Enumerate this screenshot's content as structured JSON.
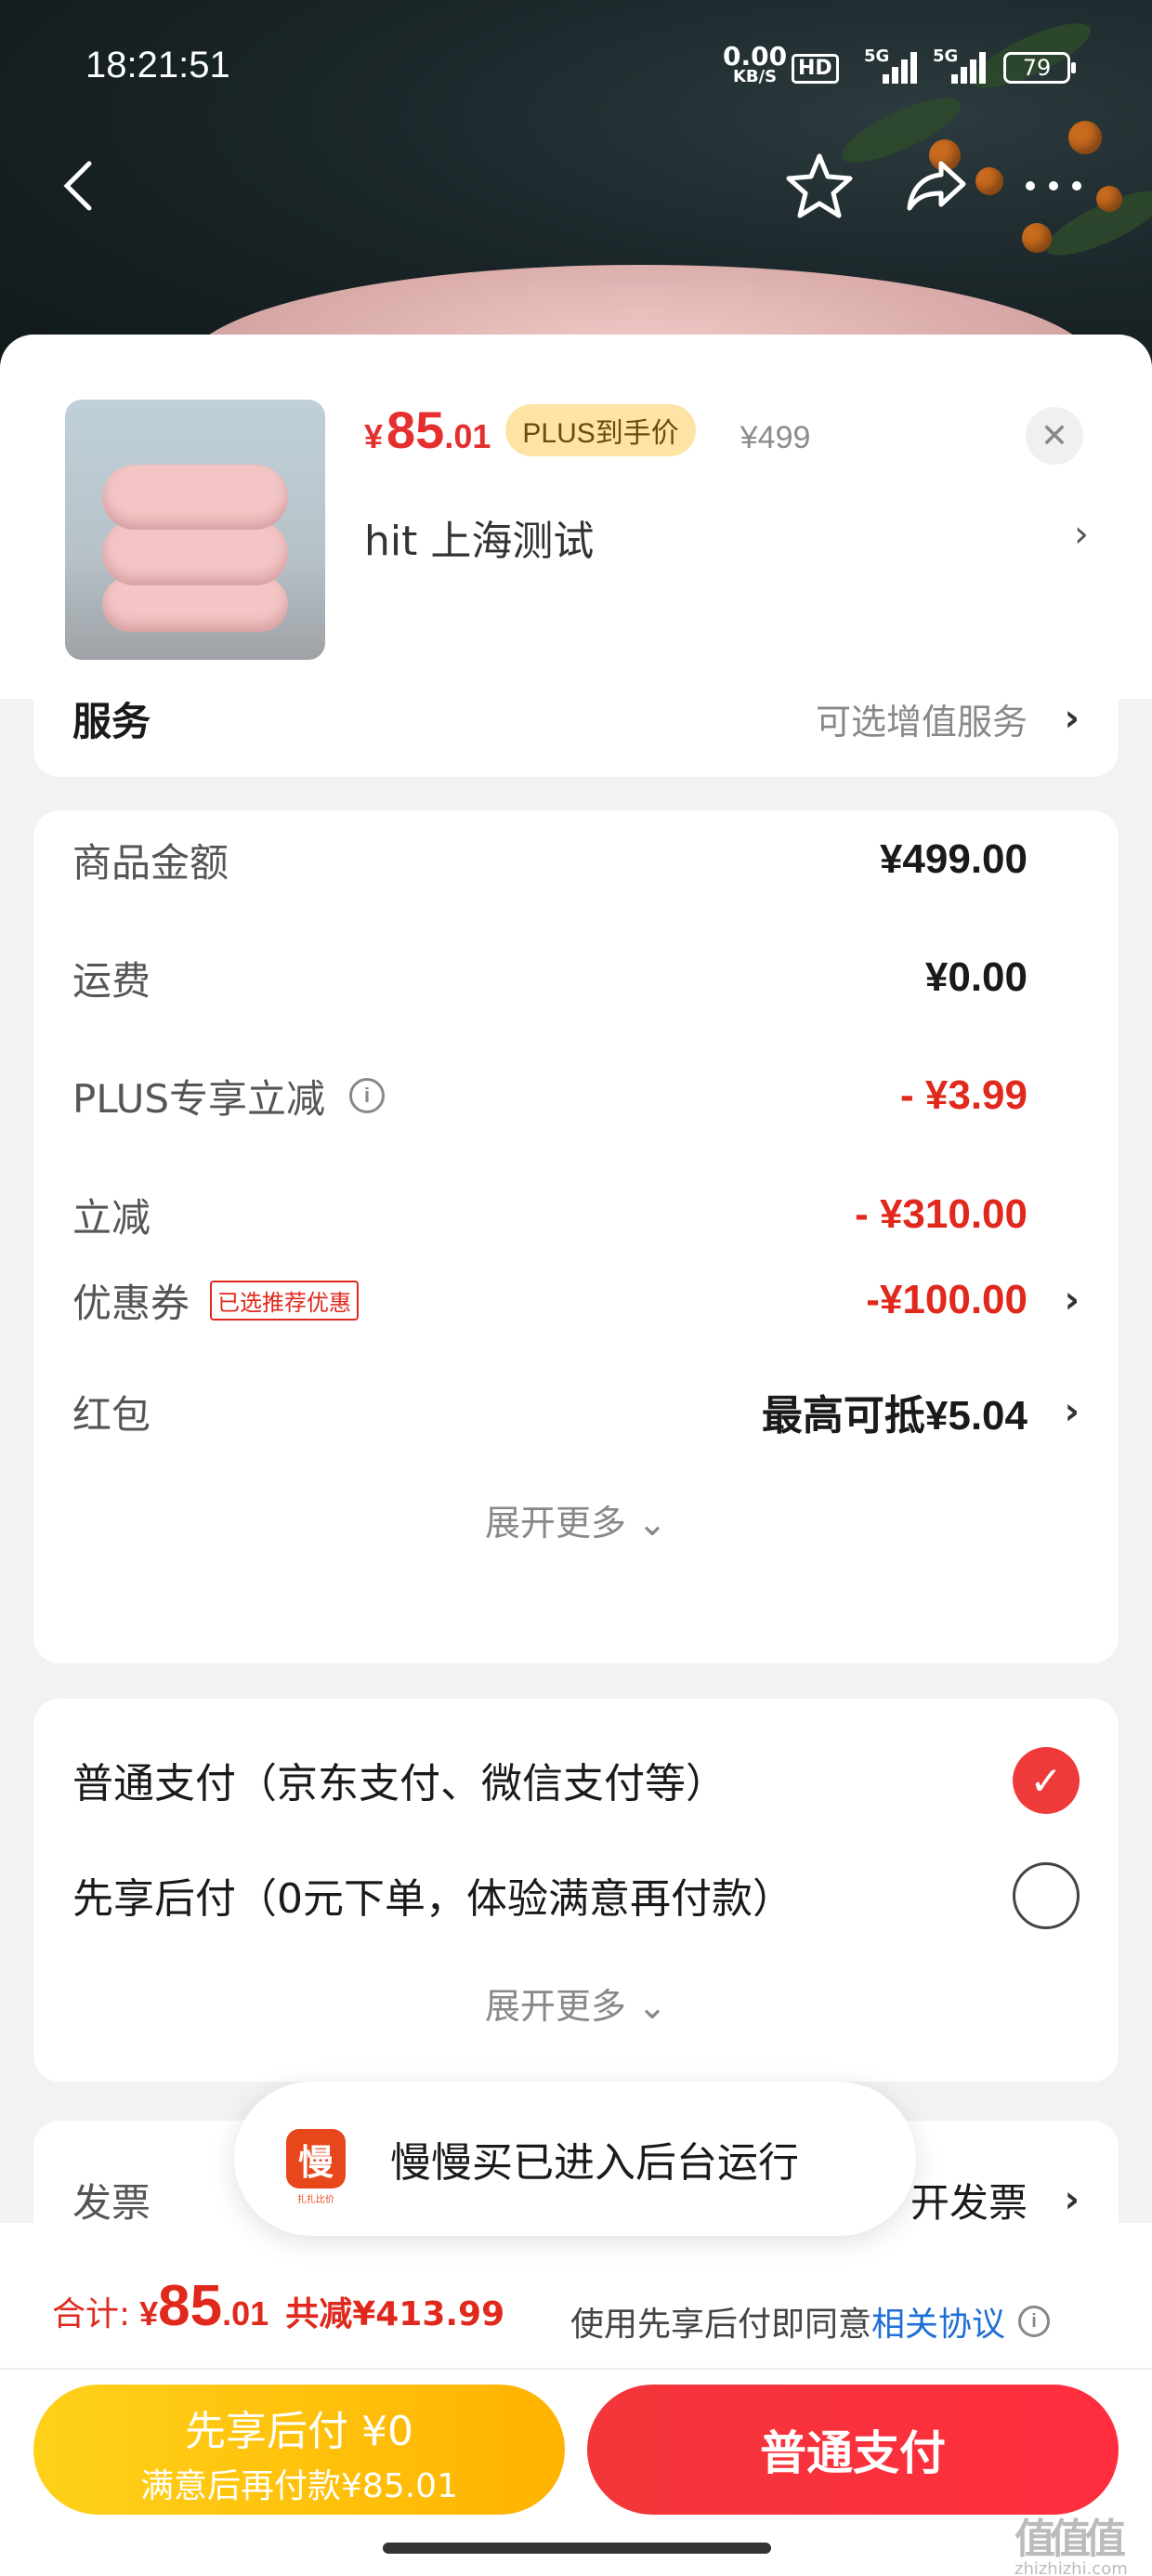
{
  "status_bar": {
    "time": "18:21:51",
    "net_speed": "0.00",
    "net_unit": "KB/S",
    "hd_label": "HD",
    "signal_1": "5G",
    "signal_2": "5G",
    "battery": "79"
  },
  "product": {
    "price_yen": "¥",
    "price_int": "85",
    "price_dec": ".01",
    "plus_tag": "PLUS到手价",
    "original_price": "¥499",
    "spec": "hit 上海测试"
  },
  "service_row": {
    "label": "服务",
    "value": "可选增值服务"
  },
  "price_detail": {
    "rows": [
      {
        "label": "商品金额",
        "value": "¥499.00"
      },
      {
        "label": "运费",
        "value": "¥0.00"
      },
      {
        "label": "PLUS专享立减",
        "value": "- ¥3.99"
      },
      {
        "label": "立减",
        "value": "- ¥310.00"
      },
      {
        "label": "优惠券",
        "tag": "已选推荐优惠",
        "value": "-¥100.00"
      },
      {
        "label": "红包",
        "value": "最高可抵¥5.04"
      }
    ],
    "expand_label": "展开更多"
  },
  "payment": {
    "options": [
      {
        "label": "普通支付（京东支付、微信支付等）",
        "selected": true
      },
      {
        "label": "先享后付（0元下单，体验满意再付款）",
        "selected": false
      }
    ],
    "expand_label": "展开更多"
  },
  "invoice_row": {
    "label": "发票",
    "value": "开发票"
  },
  "toast": {
    "app_icon_char": "慢",
    "app_icon_sub": "扎扎比价",
    "message": "慢慢买已进入后台运行"
  },
  "footer": {
    "total_label": "合计:",
    "total_yen": "¥",
    "total_int": "85",
    "total_dec": ".01",
    "saved": "共减¥413.99",
    "agree_text": "使用先享后付即同意",
    "agree_link": "相关协议",
    "btn_later_line1": "先享后付 ¥0",
    "btn_later_line2": "满意后再付款¥85.01",
    "btn_pay": "普通支付"
  },
  "watermark": {
    "main": "值值值",
    "sub": "zhizhizhi.com"
  },
  "colors": {
    "accent_red": "#e0291c",
    "plus_gold": "#fde3a4",
    "pay_later_yellow": "#ffc107",
    "link_blue": "#1f6fd6"
  }
}
